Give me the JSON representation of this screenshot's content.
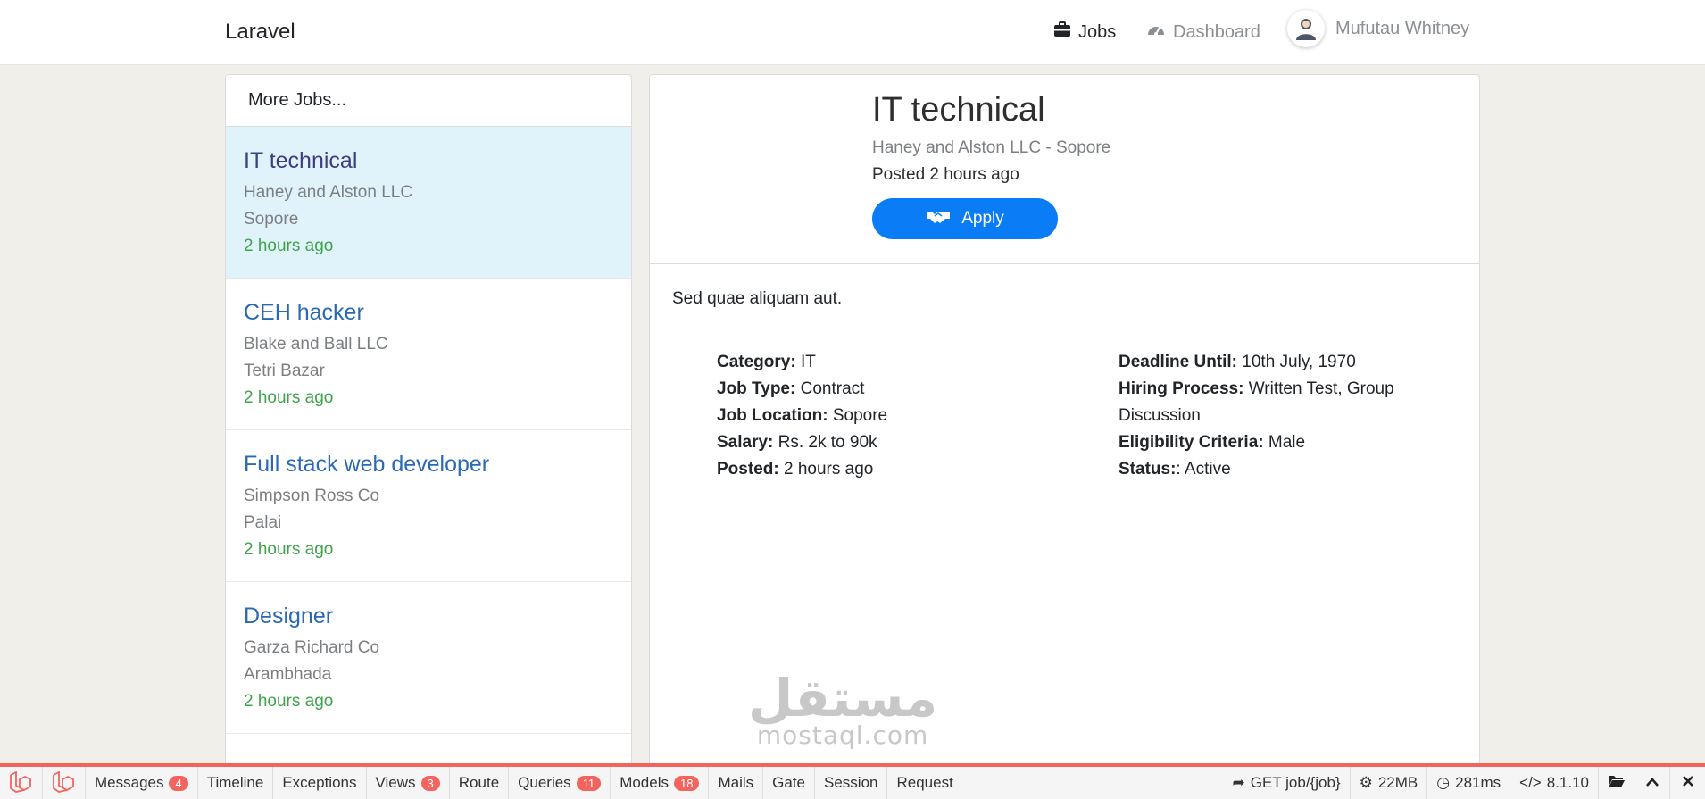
{
  "nav": {
    "brand": "Laravel",
    "jobs_label": "Jobs",
    "dashboard_label": "Dashboard",
    "user_name": "Mufutau Whitney"
  },
  "sidebar": {
    "heading": "More Jobs...",
    "jobs": [
      {
        "title": "IT technical",
        "company": "Haney and Alston LLC",
        "location": "Sopore",
        "time": "2 hours ago"
      },
      {
        "title": "CEH hacker",
        "company": "Blake and Ball LLC",
        "location": "Tetri Bazar",
        "time": "2 hours ago"
      },
      {
        "title": "Full stack web developer",
        "company": "Simpson Ross Co",
        "location": "Palai",
        "time": "2 hours ago"
      },
      {
        "title": "Designer",
        "company": "Garza Richard Co",
        "location": "Arambhada",
        "time": "2 hours ago"
      }
    ]
  },
  "detail": {
    "title": "IT technical",
    "company_location": "Haney and Alston LLC - Sopore",
    "posted": "Posted 2 hours ago",
    "apply_label": "Apply",
    "description": "Sed quae aliquam aut.",
    "left": [
      {
        "label": "Category:",
        "value": "IT"
      },
      {
        "label": "Job Type:",
        "value": "Contract"
      },
      {
        "label": "Job Location:",
        "value": "Sopore"
      },
      {
        "label": "Salary:",
        "value": "Rs. 2k to 90k"
      },
      {
        "label": "Posted:",
        "value": "2 hours ago"
      }
    ],
    "right": [
      {
        "label": "Deadline Until:",
        "value": "10th July, 1970"
      },
      {
        "label": "Hiring Process:",
        "value": "Written Test, Group Discussion"
      },
      {
        "label": "Eligibility Criteria:",
        "value": "Male"
      },
      {
        "label": "Status:",
        "value": ": Active"
      }
    ]
  },
  "watermark": {
    "arabic": "مستقل",
    "latin": "mostaql.com"
  },
  "debugbar": {
    "tabs": [
      {
        "label": "Messages",
        "badge": "4"
      },
      {
        "label": "Timeline",
        "badge": ""
      },
      {
        "label": "Exceptions",
        "badge": ""
      },
      {
        "label": "Views",
        "badge": "3"
      },
      {
        "label": "Route",
        "badge": ""
      },
      {
        "label": "Queries",
        "badge": "11"
      },
      {
        "label": "Models",
        "badge": "18"
      },
      {
        "label": "Mails",
        "badge": ""
      },
      {
        "label": "Gate",
        "badge": ""
      },
      {
        "label": "Session",
        "badge": ""
      },
      {
        "label": "Request",
        "badge": ""
      }
    ],
    "route": "GET job/{job}",
    "memory": "22MB",
    "time": "281ms",
    "php_version": "8.1.10"
  },
  "colors": {
    "accent": "#0a7cf5",
    "link": "#2a6ab5",
    "time_green": "#3fa34a",
    "debug_red": "#f4645f"
  }
}
